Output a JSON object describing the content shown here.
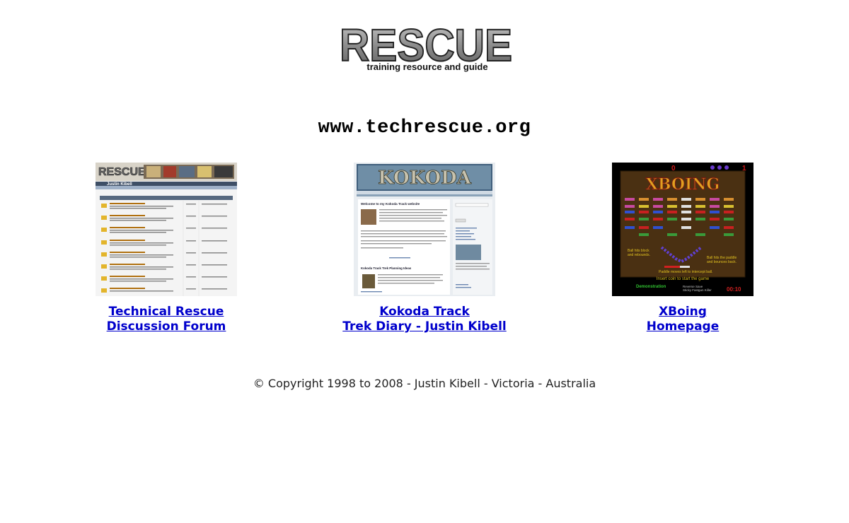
{
  "logo": {
    "wordmark": "RESCUE",
    "tagline": "training resource and guide"
  },
  "site_url": "www.techrescue.org",
  "cards": [
    {
      "thumb_caption": "Technical Rescue discussion forum screenshot",
      "thumb_brand": "RESCUE",
      "thumb_user": "Justin Kibell",
      "link_line1": "Technical Rescue",
      "link_line2": "Discussion Forum"
    },
    {
      "thumb_brand": "KOKODA",
      "thumb_heading": "Welcome to my Kokoda Track website",
      "thumb_subheading": "Kokoda Track Trek Planning Ideas",
      "link_line1": "Kokoda Track",
      "link_line2": "Trek Diary - Justin Kibell"
    },
    {
      "thumb_brand": "XBOING",
      "thumb_demo": "Demonstration",
      "thumb_insert": "Insert coin to start the game",
      "link_line1": "XBoing",
      "link_line2": "Homepage"
    }
  ],
  "copyright": "© Copyright 1998 to 2008 - Justin Kibell - Victoria - Australia",
  "colors": {
    "link": "#0000cc",
    "logo_gray": "#8a8a8a"
  }
}
